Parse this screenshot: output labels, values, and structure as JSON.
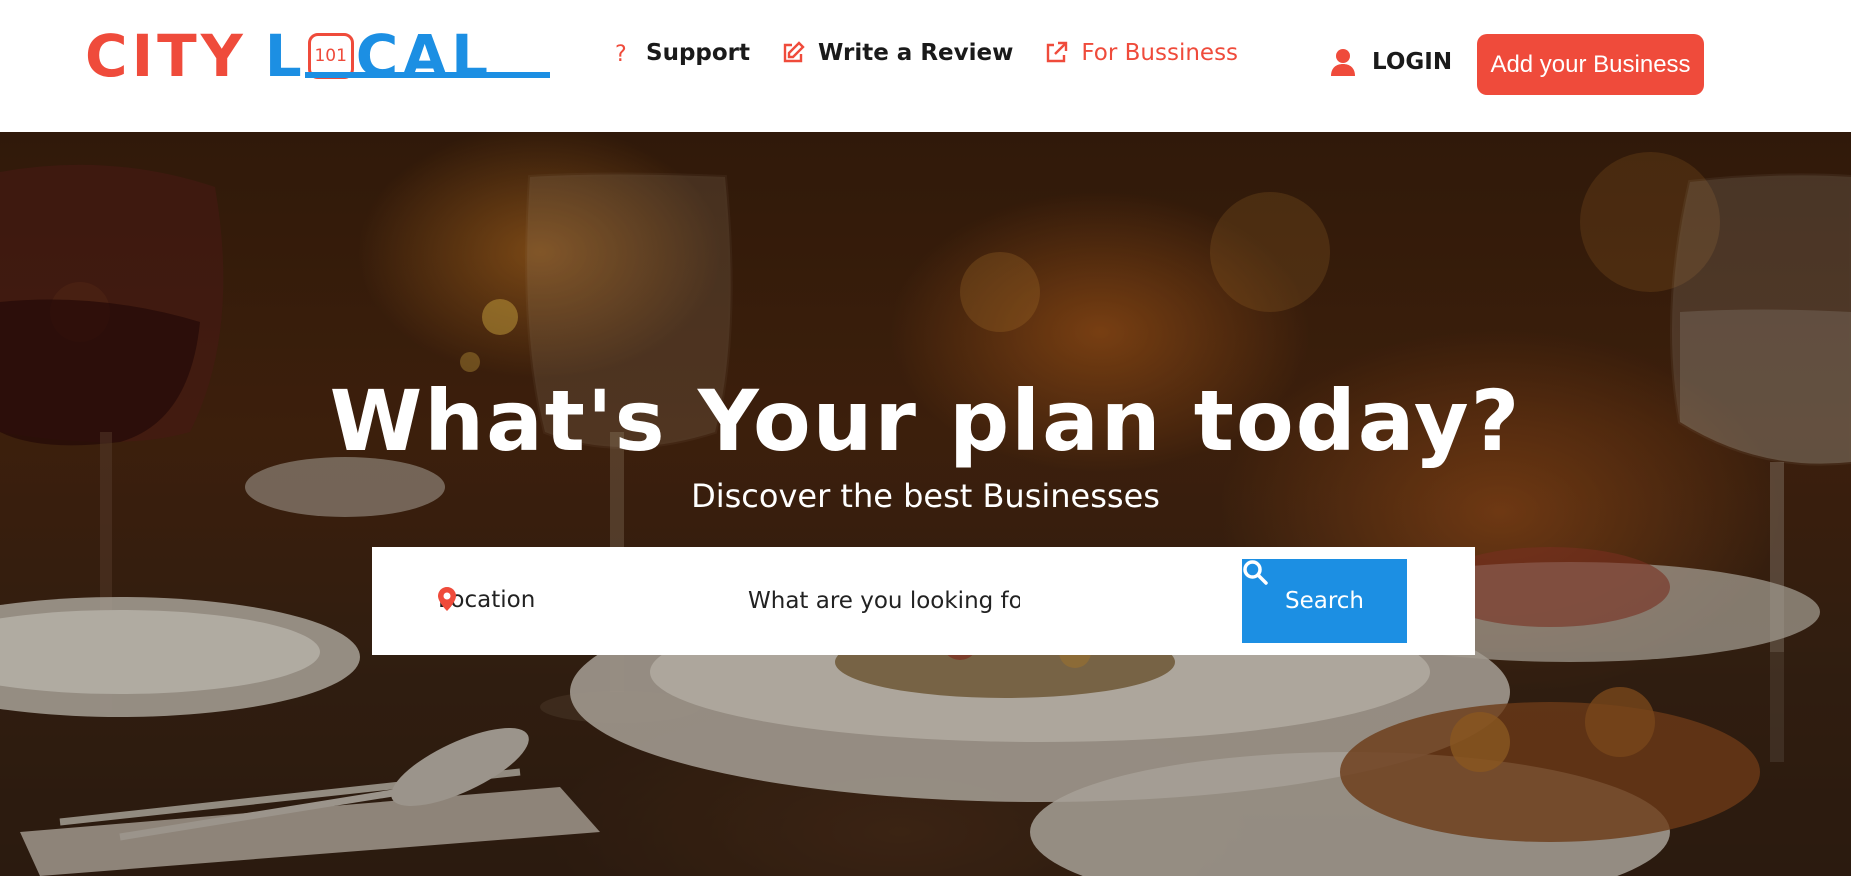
{
  "brand": {
    "logo_city": "CITY",
    "logo_local_l": "L",
    "logo_badge": "101",
    "logo_local_rest": "CAL",
    "colors": {
      "red": "#ef4b3b",
      "blue": "#1c8fe3"
    }
  },
  "nav": {
    "items": [
      {
        "label": "Support",
        "icon": "question-icon"
      },
      {
        "label": "Write a Review",
        "icon": "edit-icon"
      },
      {
        "label": "For Bussiness",
        "icon": "external-link-icon"
      }
    ],
    "login_label": "LOGIN",
    "add_business_label": "Add your Business"
  },
  "hero": {
    "title": "What's Your plan today?",
    "subtitle": "Discover the best Businesses",
    "search": {
      "location_label": "Location",
      "query_placeholder": "What are you looking for?",
      "button_label": "Search"
    }
  }
}
